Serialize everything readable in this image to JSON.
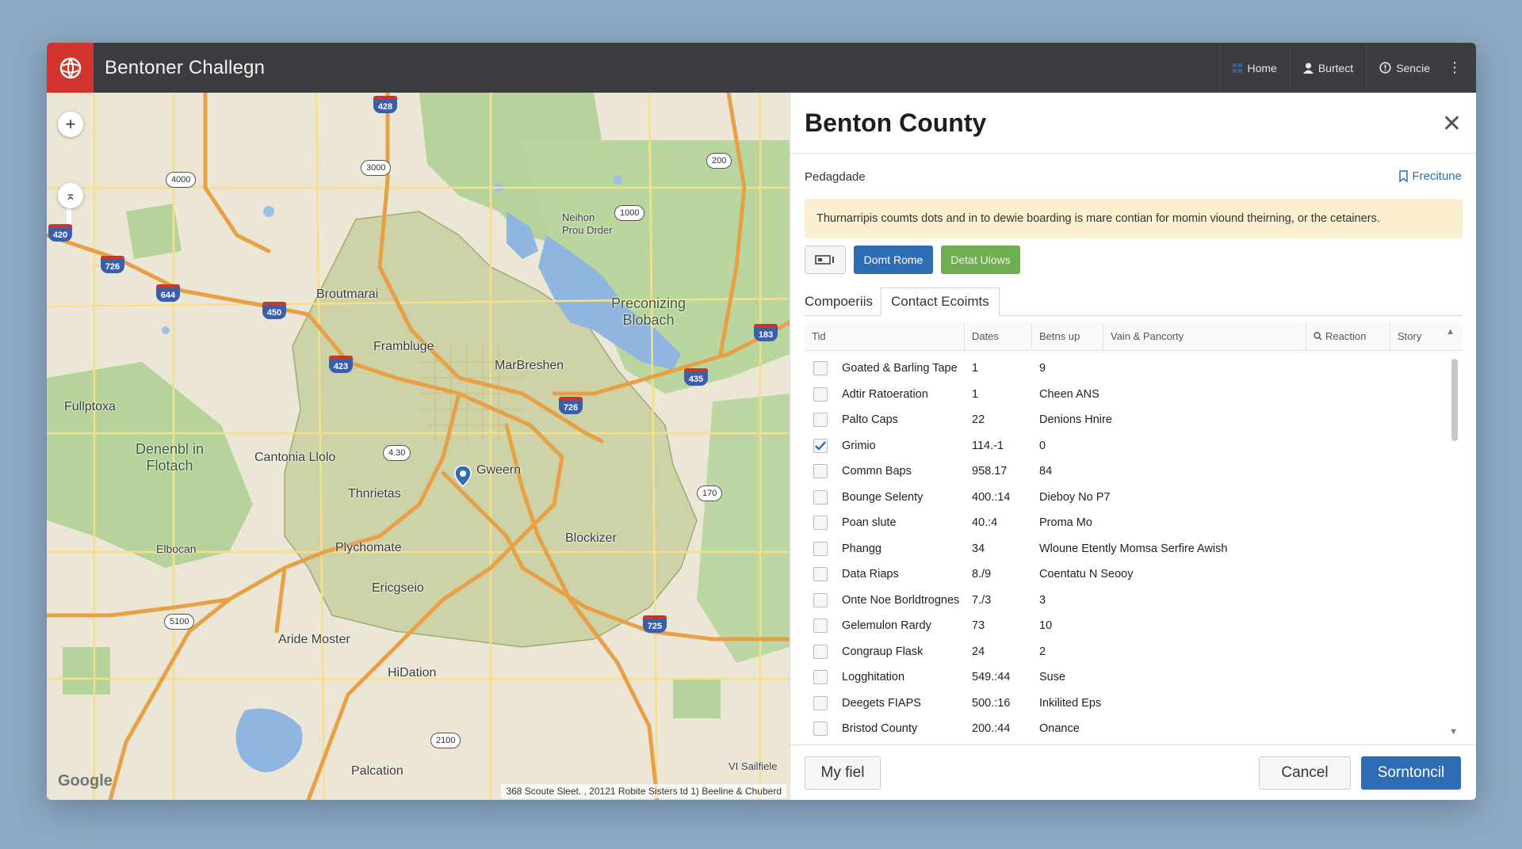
{
  "app": {
    "title": "Bentoner Challegn",
    "nav": [
      {
        "label": "Home",
        "icon": "grid-icon"
      },
      {
        "label": "Burtect",
        "icon": "user-icon"
      },
      {
        "label": "Sencie",
        "icon": "help-icon"
      }
    ],
    "more": "⋮"
  },
  "map": {
    "labels": {
      "broutmarai": "Broutmarai",
      "frambluge": "Frambluge",
      "marbreshen": "MarBreshen",
      "precon": "Preconizing\nBlobach",
      "neihon": "Neihon\nProu Drder",
      "fullptoxa": "Fullptoxa",
      "denenbl": "Denenbl in\nFlotach",
      "cantonia": "Cantonia Llolo",
      "thnrietas": "Thnrietas",
      "gweern": "Gweern",
      "blockizer": "Blockizer",
      "elbocan": "Elbocan",
      "plychomate": "Plychomate",
      "ericgseio": "Ericgseio",
      "aride": "Aride Moster",
      "hidation": "HiDation",
      "palcation": "Palcation",
      "sailfiele": "VI Sailfiele"
    },
    "shields": [
      "428",
      "420",
      "726",
      "644",
      "450",
      "423",
      "726",
      "435",
      "183",
      "725"
    ],
    "ovals": [
      "4000",
      "3000",
      "200",
      "1000",
      "4.30",
      "170",
      "5100",
      "2100"
    ],
    "attribution": "368 Scoute Sleet. , 20121    Robite Sisters td 1) Beeline & Chuberd",
    "brand": "Google",
    "zoom_in": "+",
    "compass": "⌅"
  },
  "panel": {
    "title": "Benton County",
    "close": "✕",
    "section": "Pedagdade",
    "feature_link": "Frecitune",
    "notice": "Thurnarripis coumts dots and in to dewie boarding is mare contian for momin viound theirning, or the cetainers.",
    "buttons": {
      "primary": "Domt Rome",
      "secondary": "Detat Uiows"
    },
    "tabs": [
      "Compoeriis",
      "Contact Ecoimts"
    ],
    "columns": [
      "Tid",
      "Dates",
      "Betns up",
      "Vain & Pancorty",
      "Reaction",
      "Story"
    ],
    "rows": [
      {
        "name": "Goated & Barling Tape",
        "date": "1",
        "betns": "9",
        "checked": false
      },
      {
        "name": "Adtir Ratoeration",
        "date": "1",
        "betns": "Cheen ANS",
        "checked": false
      },
      {
        "name": "Palto Caps",
        "date": "22",
        "betns": "Denions Hnire",
        "checked": false
      },
      {
        "name": "Grimio",
        "date": "114.-1",
        "betns": "0",
        "checked": true
      },
      {
        "name": "Commn Baps",
        "date": "958.17",
        "betns": "84",
        "checked": false
      },
      {
        "name": "Bounge Selenty",
        "date": "400.:14",
        "betns": "Dieboy No P7",
        "checked": false
      },
      {
        "name": "Poan slute",
        "date": "40.:4",
        "betns": "Proma Mo",
        "checked": false
      },
      {
        "name": "Phangg",
        "date": "34",
        "betns": "Wloune Etently Momsa Serfire Awish",
        "checked": false
      },
      {
        "name": "Data Riaps",
        "date": "8./9",
        "betns": "Coentatu N Seooy",
        "checked": false
      },
      {
        "name": "Onte Noe Borldtrognes",
        "date": "7./3",
        "betns": "3",
        "checked": false
      },
      {
        "name": "Gelemulon Rardy",
        "date": "73",
        "betns": "10",
        "checked": false
      },
      {
        "name": "Congraup Flask",
        "date": "24",
        "betns": "2",
        "checked": false
      },
      {
        "name": "Logghitation",
        "date": "549.:44",
        "betns": "Suse",
        "checked": false
      },
      {
        "name": "Deegets FIAPS",
        "date": "500.:16",
        "betns": "Inkilited Eps",
        "checked": false
      },
      {
        "name": "Bristod County",
        "date": "200.:44",
        "betns": "Onance",
        "checked": false
      }
    ],
    "footer": {
      "file": "My fiel",
      "cancel": "Cancel",
      "submit": "Sorntoncil"
    }
  },
  "colors": {
    "titlebar": "#3b3d40",
    "logo": "#d0342c",
    "primary": "#2e6db6",
    "success": "#6fae52",
    "notice_bg": "#faf0cf",
    "road": "#e8a046",
    "water": "#8fb6e0",
    "county": "#cdd3a5",
    "green_area": "#b5d39a"
  }
}
